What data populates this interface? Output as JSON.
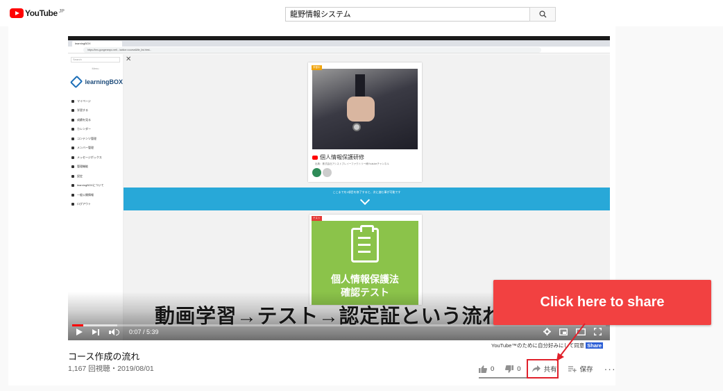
{
  "header": {
    "logo_text": "YouTube",
    "region": "JP",
    "search_value": "龍野情報システム"
  },
  "video": {
    "lms": {
      "tab_title": "learningBOX",
      "url": "https://lms.gungenexpo.net/.../action=course&file_list.html...",
      "search_placeholder": "Search",
      "menu_label": "Menu",
      "logo_text": "learningBOX",
      "menu_items": [
        "マイページ",
        "学習する",
        "成績を見る",
        "カレンダー",
        "コンテンツ管理",
        "メンバー管理",
        "メッセージボックス",
        "管理機能",
        "設定",
        "learningBOXについて",
        "一般公開情報",
        "ログアウト"
      ],
      "card1_tag": "学習中",
      "card1_title": "個人情報保護研修",
      "card1_sub": "出典：株式会社アシストプレイーファクトリー様Youtubeチャンネル",
      "banner_text": "ここまでを1項目を修了すると、次に進む事が可能です",
      "card2_tag": "テスト",
      "card2_title_line1": "個人情報保護法",
      "card2_title_line2": "確認テスト"
    },
    "subtitle": "動画学習→テスト→認定証という流れに",
    "time": "0:07 / 5:39",
    "progress_fraction": 0.021
  },
  "info": {
    "overlay_text": "YouTube™のために自分好みにして同意",
    "overlay_share": "Share",
    "title": "コース作成の流れ",
    "meta": "1,167 回視聴・2019/08/01",
    "likes": "0",
    "dislikes": "0",
    "share_label": "共有",
    "save_label": "保存"
  },
  "callout": {
    "text": "Click here to share"
  },
  "colors": {
    "youtube_red": "#ff0000",
    "callout_red": "#f24141",
    "banner_blue": "#28a8d8",
    "card_green": "#8bc34a"
  }
}
